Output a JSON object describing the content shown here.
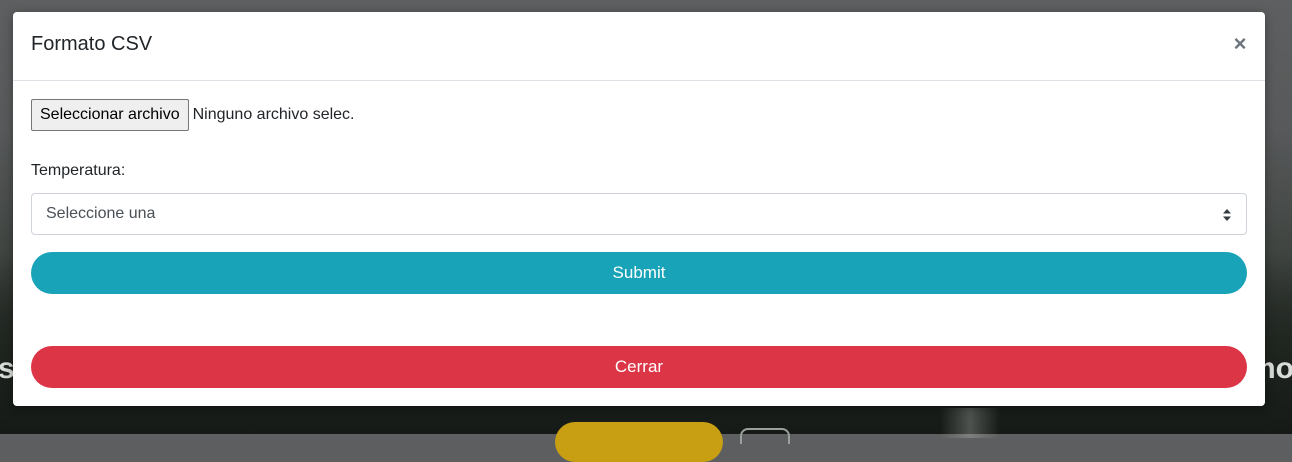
{
  "background": {
    "heading_left": "s",
    "heading_right": "mo"
  },
  "modal": {
    "title": "Formato CSV",
    "close_symbol": "×",
    "file_input": {
      "button_label": "Seleccionar archivo",
      "status_text": "Ninguno archivo selec."
    },
    "temperature": {
      "label": "Temperatura:",
      "selected": "Seleccione una"
    },
    "submit_label": "Submit",
    "close_label": "Cerrar"
  },
  "colors": {
    "submit": "#19a3b8",
    "close": "#dc3545"
  }
}
